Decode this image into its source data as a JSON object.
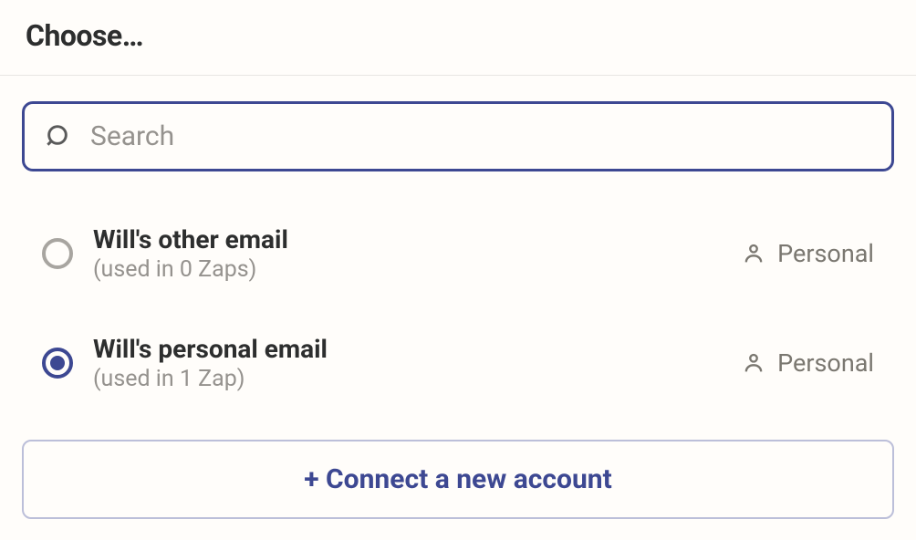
{
  "header": {
    "title": "Choose…"
  },
  "search": {
    "placeholder": "Search",
    "value": ""
  },
  "options": [
    {
      "title": "Will's other email",
      "sub": "(used in 0 Zaps)",
      "scope": "Personal",
      "selected": false
    },
    {
      "title": "Will's personal email",
      "sub": "(used in 1 Zap)",
      "scope": "Personal",
      "selected": true
    }
  ],
  "connect": {
    "label": "+ Connect a new account"
  }
}
